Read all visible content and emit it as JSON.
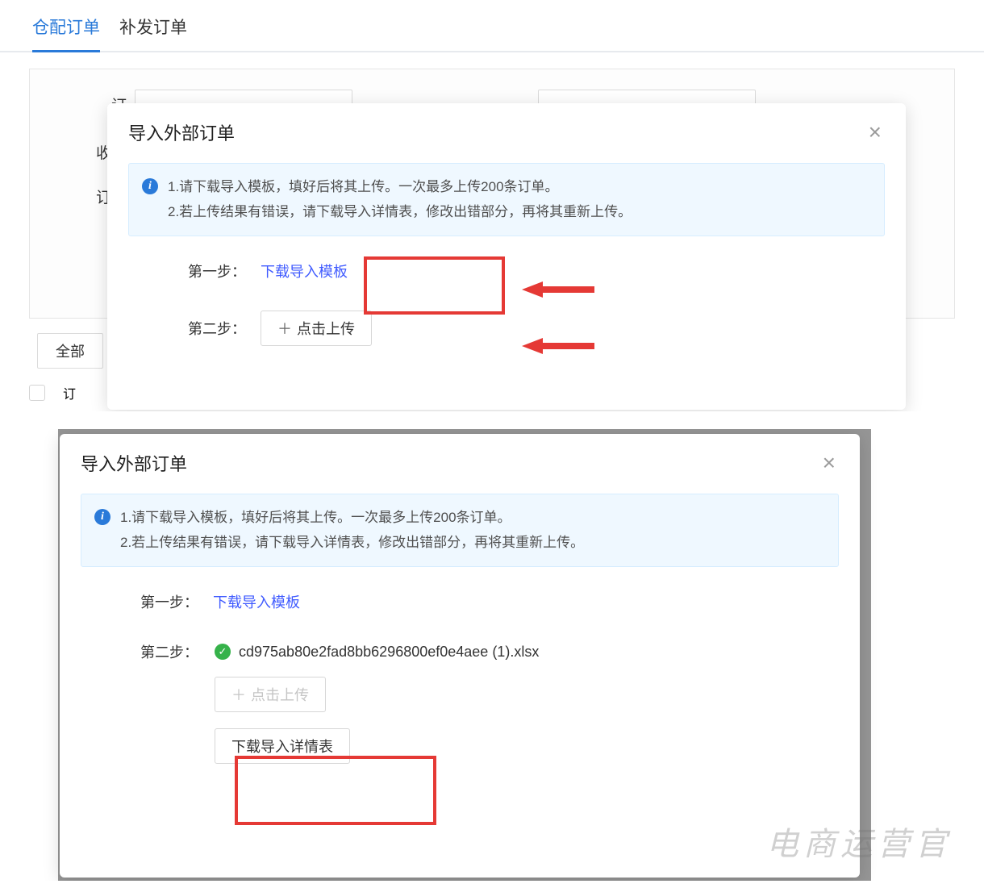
{
  "tabs": {
    "active": "仓配订单",
    "inactive": "补发订单"
  },
  "bg_form": {
    "label1": "订",
    "label2": "收货",
    "label3": "订单",
    "button_all": "全部",
    "row_col_prefix": "订"
  },
  "modal": {
    "title": "导入外部订单",
    "notice_line1": "1.请下载导入模板，填好后将其上传。一次最多上传200条订单。",
    "notice_line2": "2.若上传结果有错误，请下载导入详情表，修改出错部分，再将其重新上传。",
    "step1_label": "第一步：",
    "step1_link": "下载导入模板",
    "step2_label": "第二步：",
    "step2_upload": "点击上传",
    "step2_details": "下载导入详情表",
    "uploaded_filename": "cd975ab80e2fad8bb6296800ef0e4aee (1).xlsx"
  },
  "watermark": "电商运营官"
}
